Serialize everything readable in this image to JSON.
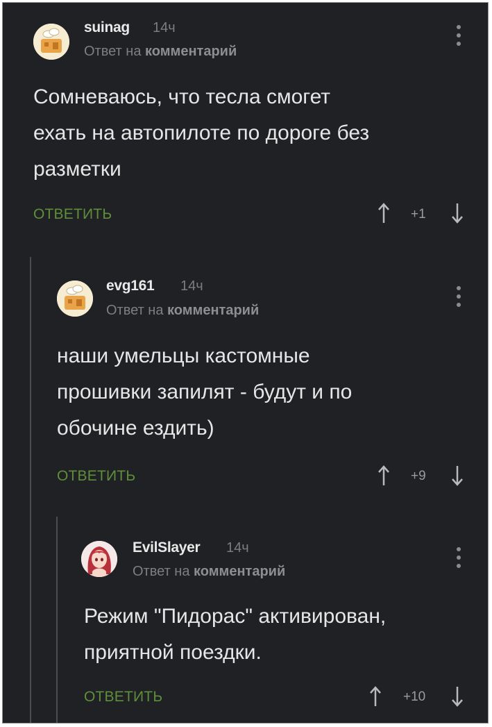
{
  "comments": [
    {
      "username": "suinag",
      "time": "14ч",
      "reply_prefix": "Ответ на",
      "reply_target": "комментарий",
      "text_lines": [
        "Сомневаюсь, что тесла смогет",
        "ехать на автопилоте по дороге без",
        "разметки"
      ],
      "reply_label": "ОТВЕТИТЬ",
      "score": "+1",
      "avatar_icon": "default-avatar-icon"
    },
    {
      "username": "evg161",
      "time": "14ч",
      "reply_prefix": "Ответ на",
      "reply_target": "комментарий",
      "text_lines": [
        "наши умельцы кастомные",
        "прошивки запилят - будут и по",
        "обочине ездить)"
      ],
      "reply_label": "ОТВЕТИТЬ",
      "score": "+9",
      "avatar_icon": "default-avatar-icon"
    },
    {
      "username": "EvilSlayer",
      "time": "14ч",
      "reply_prefix": "Ответ на",
      "reply_target": "комментарий",
      "text_lines": [
        "Режим \"Пидорас\" активирован,",
        "приятной поездки."
      ],
      "reply_label": "ОТВЕТИТЬ",
      "score": "+10",
      "avatar_icon": "anime-girl-avatar-icon"
    }
  ],
  "colors": {
    "background": "#1f2124",
    "accent_green": "#5f8f3a",
    "text": "#e6e6e6",
    "muted": "#7d7f82"
  }
}
